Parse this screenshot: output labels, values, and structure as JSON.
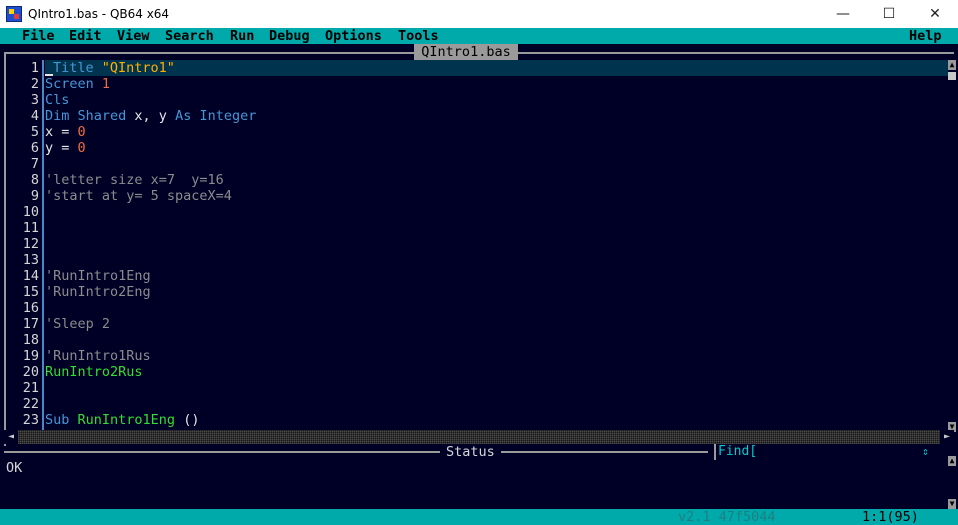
{
  "window": {
    "title": "QIntro1.bas - QB64 x64",
    "controls": {
      "minimize": "—",
      "maximize": "☐",
      "close": "✕"
    }
  },
  "menu": {
    "items": [
      "File",
      "Edit",
      "View",
      "Search",
      "Run",
      "Debug",
      "Options",
      "Tools"
    ],
    "help": "Help"
  },
  "editor": {
    "file_tab": "QIntro1.bas",
    "lines": [
      {
        "n": "1",
        "segments": [
          {
            "t": "_Title",
            "c": "kw"
          },
          {
            "t": " "
          },
          {
            "t": "\"QIntro1\"",
            "c": "str"
          }
        ]
      },
      {
        "n": "2",
        "segments": [
          {
            "t": "Screen",
            "c": "kw"
          },
          {
            "t": " "
          },
          {
            "t": "1",
            "c": "num"
          }
        ]
      },
      {
        "n": "3",
        "segments": [
          {
            "t": "Cls",
            "c": "kw"
          }
        ]
      },
      {
        "n": "4",
        "segments": [
          {
            "t": "Dim Shared",
            "c": "kw"
          },
          {
            "t": " x, y "
          },
          {
            "t": "As Integer",
            "c": "kw"
          }
        ]
      },
      {
        "n": "5",
        "segments": [
          {
            "t": "x = "
          },
          {
            "t": "0",
            "c": "num"
          }
        ]
      },
      {
        "n": "6",
        "segments": [
          {
            "t": "y = "
          },
          {
            "t": "0",
            "c": "num"
          }
        ]
      },
      {
        "n": "7",
        "segments": []
      },
      {
        "n": "8",
        "segments": [
          {
            "t": "'letter size x=7  y=16",
            "c": "cmt"
          }
        ]
      },
      {
        "n": "9",
        "segments": [
          {
            "t": "'start at y= 5 spaceX=4",
            "c": "cmt"
          }
        ]
      },
      {
        "n": "10",
        "segments": []
      },
      {
        "n": "11",
        "segments": []
      },
      {
        "n": "12",
        "segments": []
      },
      {
        "n": "13",
        "segments": []
      },
      {
        "n": "14",
        "segments": [
          {
            "t": "'RunIntro1Eng",
            "c": "cmt"
          }
        ]
      },
      {
        "n": "15",
        "segments": [
          {
            "t": "'RunIntro2Eng",
            "c": "cmt"
          }
        ]
      },
      {
        "n": "16",
        "segments": []
      },
      {
        "n": "17",
        "segments": [
          {
            "t": "'Sleep 2",
            "c": "cmt"
          }
        ]
      },
      {
        "n": "18",
        "segments": []
      },
      {
        "n": "19",
        "segments": [
          {
            "t": "'RunIntro1Rus",
            "c": "cmt"
          }
        ]
      },
      {
        "n": "20",
        "segments": [
          {
            "t": "RunIntro2Rus",
            "c": "sub"
          }
        ]
      },
      {
        "n": "21",
        "segments": []
      },
      {
        "n": "22",
        "segments": []
      },
      {
        "n": "23",
        "segments": [
          {
            "t": "Sub",
            "c": "kw"
          },
          {
            "t": " "
          },
          {
            "t": "RunIntro1Eng",
            "c": "sub"
          },
          {
            "t": " ()"
          }
        ]
      }
    ]
  },
  "status": {
    "label": "Status",
    "find_label": "Find[",
    "find_arrows": "⇕",
    "message": "OK"
  },
  "bottom": {
    "version": "v2.1 47f5044",
    "position": "1:1(95)"
  },
  "colors": {
    "background": "#000027",
    "menu_bar": "#00aaaa",
    "keyword": "#4596d6",
    "number": "#f26a44",
    "string": "#ffb000",
    "comment": "#8c8c8c",
    "sub_name": "#33dd33"
  }
}
